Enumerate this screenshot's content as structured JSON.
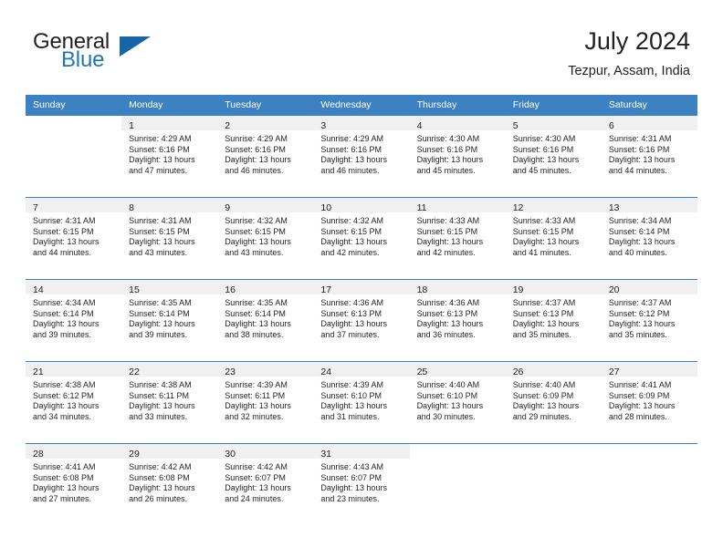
{
  "brand": {
    "word1": "General",
    "word2": "Blue",
    "triangle_color": "#1565a8",
    "blue_color": "#2077b8"
  },
  "header": {
    "title": "July 2024",
    "subtitle": "Tezpur, Assam, India"
  },
  "theme": {
    "header_bg": "#3c81c1",
    "daynum_band": "#f0f0f0",
    "text": "#231f20"
  },
  "weekday_headers": [
    "Sunday",
    "Monday",
    "Tuesday",
    "Wednesday",
    "Thursday",
    "Friday",
    "Saturday"
  ],
  "weeks": [
    [
      {
        "empty": true
      },
      {
        "day": "1",
        "sunrise": "Sunrise: 4:29 AM",
        "sunset": "Sunset: 6:16 PM",
        "daylight1": "Daylight: 13 hours",
        "daylight2": "and 47 minutes."
      },
      {
        "day": "2",
        "sunrise": "Sunrise: 4:29 AM",
        "sunset": "Sunset: 6:16 PM",
        "daylight1": "Daylight: 13 hours",
        "daylight2": "and 46 minutes."
      },
      {
        "day": "3",
        "sunrise": "Sunrise: 4:29 AM",
        "sunset": "Sunset: 6:16 PM",
        "daylight1": "Daylight: 13 hours",
        "daylight2": "and 46 minutes."
      },
      {
        "day": "4",
        "sunrise": "Sunrise: 4:30 AM",
        "sunset": "Sunset: 6:16 PM",
        "daylight1": "Daylight: 13 hours",
        "daylight2": "and 45 minutes."
      },
      {
        "day": "5",
        "sunrise": "Sunrise: 4:30 AM",
        "sunset": "Sunset: 6:16 PM",
        "daylight1": "Daylight: 13 hours",
        "daylight2": "and 45 minutes."
      },
      {
        "day": "6",
        "sunrise": "Sunrise: 4:31 AM",
        "sunset": "Sunset: 6:16 PM",
        "daylight1": "Daylight: 13 hours",
        "daylight2": "and 44 minutes."
      }
    ],
    [
      {
        "day": "7",
        "sunrise": "Sunrise: 4:31 AM",
        "sunset": "Sunset: 6:15 PM",
        "daylight1": "Daylight: 13 hours",
        "daylight2": "and 44 minutes."
      },
      {
        "day": "8",
        "sunrise": "Sunrise: 4:31 AM",
        "sunset": "Sunset: 6:15 PM",
        "daylight1": "Daylight: 13 hours",
        "daylight2": "and 43 minutes."
      },
      {
        "day": "9",
        "sunrise": "Sunrise: 4:32 AM",
        "sunset": "Sunset: 6:15 PM",
        "daylight1": "Daylight: 13 hours",
        "daylight2": "and 43 minutes."
      },
      {
        "day": "10",
        "sunrise": "Sunrise: 4:32 AM",
        "sunset": "Sunset: 6:15 PM",
        "daylight1": "Daylight: 13 hours",
        "daylight2": "and 42 minutes."
      },
      {
        "day": "11",
        "sunrise": "Sunrise: 4:33 AM",
        "sunset": "Sunset: 6:15 PM",
        "daylight1": "Daylight: 13 hours",
        "daylight2": "and 42 minutes."
      },
      {
        "day": "12",
        "sunrise": "Sunrise: 4:33 AM",
        "sunset": "Sunset: 6:15 PM",
        "daylight1": "Daylight: 13 hours",
        "daylight2": "and 41 minutes."
      },
      {
        "day": "13",
        "sunrise": "Sunrise: 4:34 AM",
        "sunset": "Sunset: 6:14 PM",
        "daylight1": "Daylight: 13 hours",
        "daylight2": "and 40 minutes."
      }
    ],
    [
      {
        "day": "14",
        "sunrise": "Sunrise: 4:34 AM",
        "sunset": "Sunset: 6:14 PM",
        "daylight1": "Daylight: 13 hours",
        "daylight2": "and 39 minutes."
      },
      {
        "day": "15",
        "sunrise": "Sunrise: 4:35 AM",
        "sunset": "Sunset: 6:14 PM",
        "daylight1": "Daylight: 13 hours",
        "daylight2": "and 39 minutes."
      },
      {
        "day": "16",
        "sunrise": "Sunrise: 4:35 AM",
        "sunset": "Sunset: 6:14 PM",
        "daylight1": "Daylight: 13 hours",
        "daylight2": "and 38 minutes."
      },
      {
        "day": "17",
        "sunrise": "Sunrise: 4:36 AM",
        "sunset": "Sunset: 6:13 PM",
        "daylight1": "Daylight: 13 hours",
        "daylight2": "and 37 minutes."
      },
      {
        "day": "18",
        "sunrise": "Sunrise: 4:36 AM",
        "sunset": "Sunset: 6:13 PM",
        "daylight1": "Daylight: 13 hours",
        "daylight2": "and 36 minutes."
      },
      {
        "day": "19",
        "sunrise": "Sunrise: 4:37 AM",
        "sunset": "Sunset: 6:13 PM",
        "daylight1": "Daylight: 13 hours",
        "daylight2": "and 35 minutes."
      },
      {
        "day": "20",
        "sunrise": "Sunrise: 4:37 AM",
        "sunset": "Sunset: 6:12 PM",
        "daylight1": "Daylight: 13 hours",
        "daylight2": "and 35 minutes."
      }
    ],
    [
      {
        "day": "21",
        "sunrise": "Sunrise: 4:38 AM",
        "sunset": "Sunset: 6:12 PM",
        "daylight1": "Daylight: 13 hours",
        "daylight2": "and 34 minutes."
      },
      {
        "day": "22",
        "sunrise": "Sunrise: 4:38 AM",
        "sunset": "Sunset: 6:11 PM",
        "daylight1": "Daylight: 13 hours",
        "daylight2": "and 33 minutes."
      },
      {
        "day": "23",
        "sunrise": "Sunrise: 4:39 AM",
        "sunset": "Sunset: 6:11 PM",
        "daylight1": "Daylight: 13 hours",
        "daylight2": "and 32 minutes."
      },
      {
        "day": "24",
        "sunrise": "Sunrise: 4:39 AM",
        "sunset": "Sunset: 6:10 PM",
        "daylight1": "Daylight: 13 hours",
        "daylight2": "and 31 minutes."
      },
      {
        "day": "25",
        "sunrise": "Sunrise: 4:40 AM",
        "sunset": "Sunset: 6:10 PM",
        "daylight1": "Daylight: 13 hours",
        "daylight2": "and 30 minutes."
      },
      {
        "day": "26",
        "sunrise": "Sunrise: 4:40 AM",
        "sunset": "Sunset: 6:09 PM",
        "daylight1": "Daylight: 13 hours",
        "daylight2": "and 29 minutes."
      },
      {
        "day": "27",
        "sunrise": "Sunrise: 4:41 AM",
        "sunset": "Sunset: 6:09 PM",
        "daylight1": "Daylight: 13 hours",
        "daylight2": "and 28 minutes."
      }
    ],
    [
      {
        "day": "28",
        "sunrise": "Sunrise: 4:41 AM",
        "sunset": "Sunset: 6:08 PM",
        "daylight1": "Daylight: 13 hours",
        "daylight2": "and 27 minutes."
      },
      {
        "day": "29",
        "sunrise": "Sunrise: 4:42 AM",
        "sunset": "Sunset: 6:08 PM",
        "daylight1": "Daylight: 13 hours",
        "daylight2": "and 26 minutes."
      },
      {
        "day": "30",
        "sunrise": "Sunrise: 4:42 AM",
        "sunset": "Sunset: 6:07 PM",
        "daylight1": "Daylight: 13 hours",
        "daylight2": "and 24 minutes."
      },
      {
        "day": "31",
        "sunrise": "Sunrise: 4:43 AM",
        "sunset": "Sunset: 6:07 PM",
        "daylight1": "Daylight: 13 hours",
        "daylight2": "and 23 minutes."
      },
      {
        "empty": true
      },
      {
        "empty": true
      },
      {
        "empty": true
      }
    ]
  ]
}
